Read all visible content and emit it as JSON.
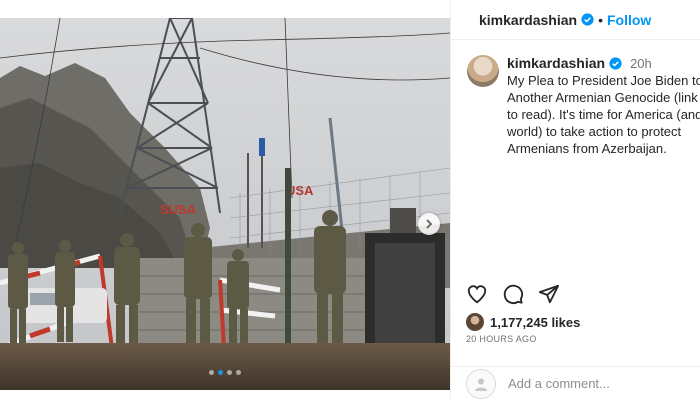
{
  "header": {
    "username": "kimkardashian",
    "separator": "•",
    "follow_label": "Follow",
    "verified_icon": "verified-badge-icon"
  },
  "caption": {
    "username": "kimkardashian",
    "time": "20h",
    "lines": [
      "My Plea to President Joe Biden to",
      "Another Armenian Genocide (link i",
      "to read). It's time for America (and",
      "world) to take action to protect",
      "Armenians from Azerbaijan."
    ]
  },
  "photo": {
    "sign_text": "USA",
    "mountain_text": "SUSA",
    "carousel_dots": 4,
    "active_dot": 1
  },
  "actions": {
    "icons": [
      "heart-icon",
      "comment-icon",
      "share-icon"
    ]
  },
  "likes": {
    "count": "1,177,245 likes"
  },
  "timestamp": "20 HOURS AGO",
  "comment": {
    "placeholder": "Add a comment..."
  },
  "colors": {
    "accent": "#0095f6",
    "text": "#262626",
    "muted": "#737373"
  }
}
